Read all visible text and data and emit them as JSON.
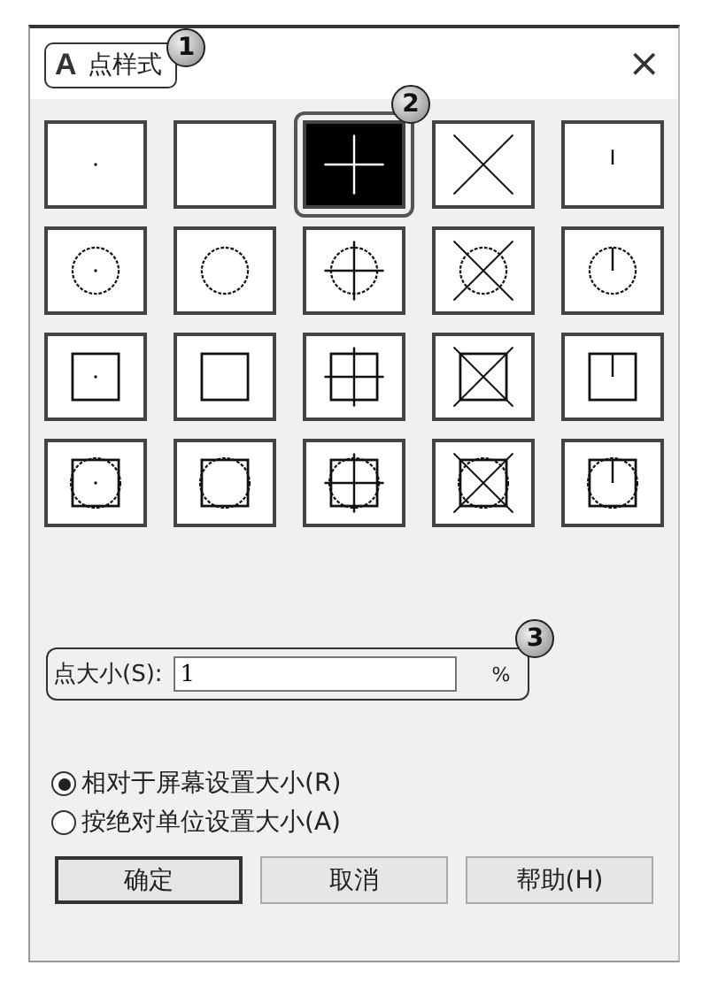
{
  "title": {
    "app_icon": "A",
    "text": "点样式",
    "callout": "1"
  },
  "close": "×",
  "grid": {
    "callout": "2",
    "rows": [
      {
        "kind": "plain",
        "styles": [
          {
            "kind": "dot",
            "selected": false
          },
          {
            "kind": "blank",
            "selected": false
          },
          {
            "kind": "plus",
            "selected": true
          },
          {
            "kind": "cross",
            "selected": false
          },
          {
            "kind": "tick",
            "selected": false
          }
        ]
      },
      {
        "kind": "circle",
        "styles": [
          {
            "kind": "dot",
            "selected": false
          },
          {
            "kind": "blank",
            "selected": false
          },
          {
            "kind": "plus",
            "selected": false
          },
          {
            "kind": "cross",
            "selected": false
          },
          {
            "kind": "tick",
            "selected": false
          }
        ]
      },
      {
        "kind": "square",
        "styles": [
          {
            "kind": "dot",
            "selected": false
          },
          {
            "kind": "blank",
            "selected": false
          },
          {
            "kind": "plus",
            "selected": false
          },
          {
            "kind": "cross",
            "selected": false
          },
          {
            "kind": "tick",
            "selected": false
          }
        ]
      },
      {
        "kind": "both",
        "styles": [
          {
            "kind": "dot",
            "selected": false
          },
          {
            "kind": "blank",
            "selected": false
          },
          {
            "kind": "plus",
            "selected": false
          },
          {
            "kind": "cross",
            "selected": false
          },
          {
            "kind": "tick",
            "selected": false
          }
        ]
      }
    ]
  },
  "size": {
    "label": "点大小(S):",
    "value": "1",
    "unit": "%",
    "callout": "3"
  },
  "mode": [
    {
      "label": "相对于屏幕设置大小(R)",
      "selected": true
    },
    {
      "label": "按绝对单位设置大小(A)",
      "selected": false
    }
  ],
  "buttons": [
    {
      "label": "确定",
      "default": true
    },
    {
      "label": "取消",
      "default": false
    },
    {
      "label": "帮助(H)",
      "default": false
    }
  ]
}
